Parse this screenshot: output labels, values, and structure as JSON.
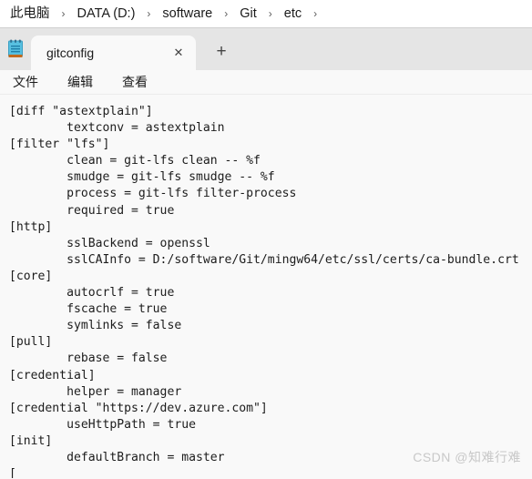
{
  "breadcrumb": {
    "separator": "›",
    "items": [
      {
        "label": "此电脑"
      },
      {
        "label": "DATA (D:)"
      },
      {
        "label": "software"
      },
      {
        "label": "Git"
      },
      {
        "label": "etc"
      }
    ]
  },
  "tabs": {
    "app_icon_name": "notepad-icon",
    "items": [
      {
        "title": "gitconfig",
        "close_glyph": "✕",
        "active": true
      }
    ],
    "new_tab_glyph": "+"
  },
  "menubar": {
    "items": [
      {
        "label": "文件"
      },
      {
        "label": "编辑"
      },
      {
        "label": "查看"
      }
    ]
  },
  "editor": {
    "filename": "gitconfig",
    "content": "[diff \"astextplain\"]\n\ttextconv = astextplain\n[filter \"lfs\"]\n\tclean = git-lfs clean -- %f\n\tsmudge = git-lfs smudge -- %f\n\tprocess = git-lfs filter-process\n\trequired = true\n[http]\n\tsslBackend = openssl\n\tsslCAInfo = D:/software/Git/mingw64/etc/ssl/certs/ca-bundle.crt\n[core]\n\tautocrlf = true\n\tfscache = true\n\tsymlinks = false\n[pull]\n\trebase = false\n[credential]\n\thelper = manager\n[credential \"https://dev.azure.com\"]\n\tuseHttpPath = true\n[init]\n\tdefaultBranch = master\n["
  },
  "watermark": {
    "text": "CSDN @知难行难"
  },
  "colors": {
    "breadcrumb_bg": "#ffffff",
    "tabstrip_bg": "#e5e5e5",
    "active_tab_bg": "#f9f9f9",
    "editor_bg": "#f9f9f9",
    "text": "#1c1c1c",
    "watermark": "#c8c8c8",
    "icon_blue": "#58c0e0"
  }
}
